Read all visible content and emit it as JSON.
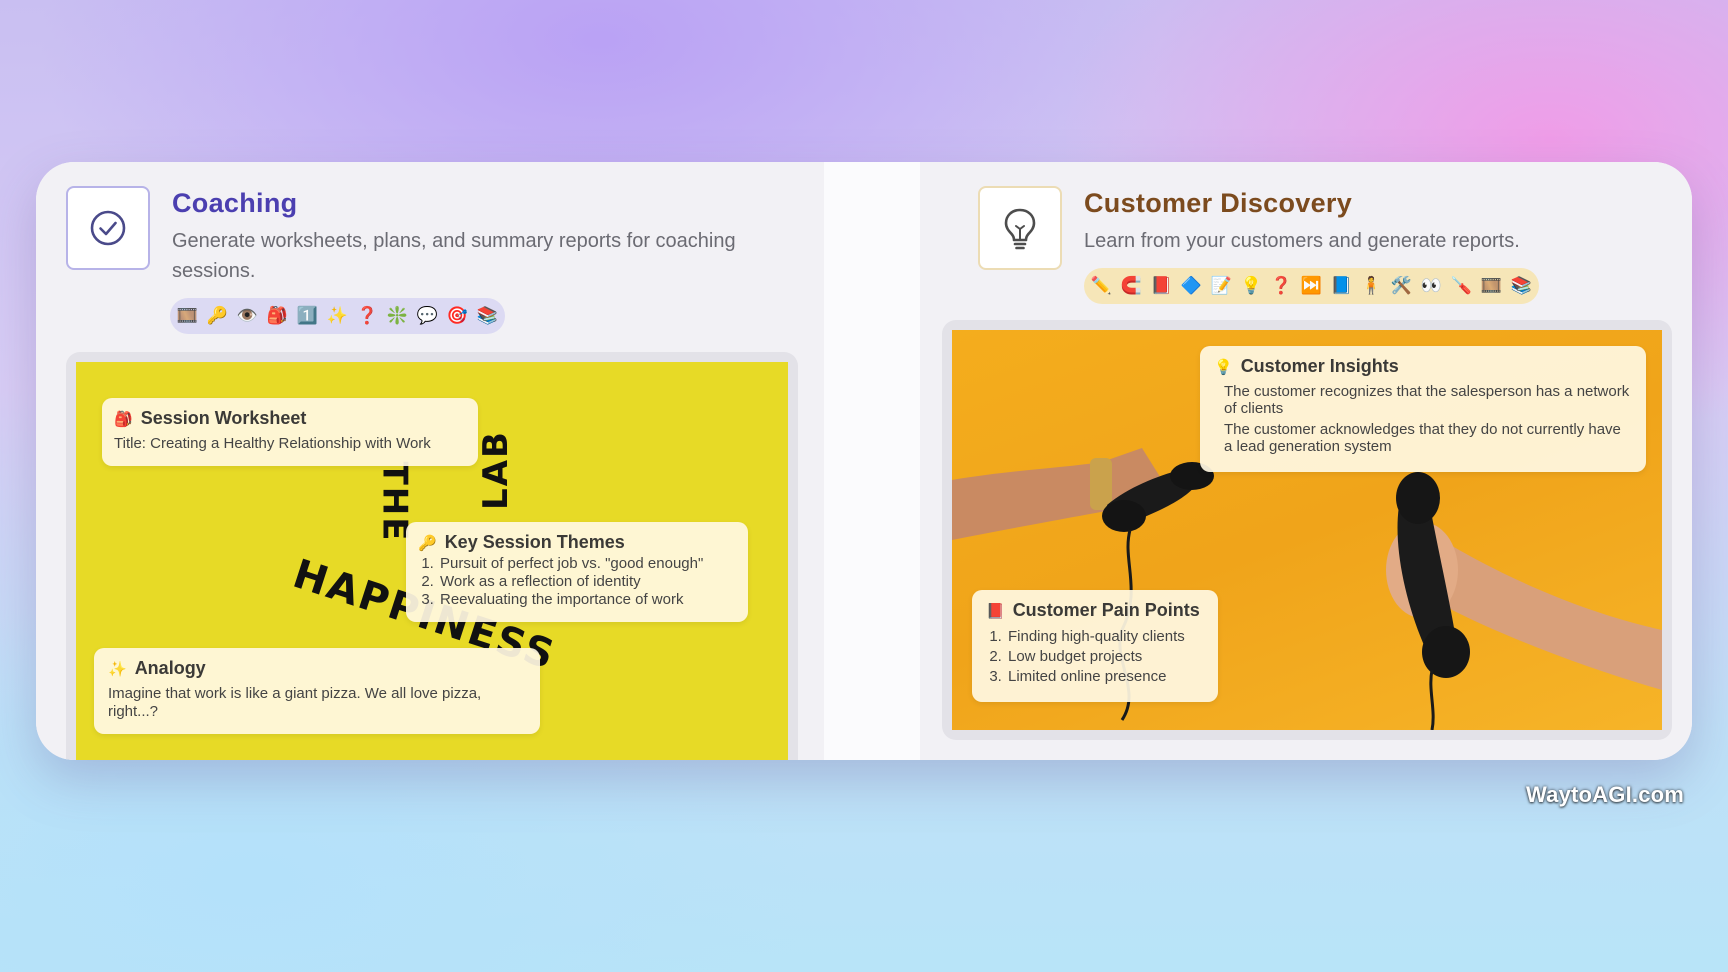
{
  "coaching": {
    "icon": "check-circle-icon",
    "title": "Coaching",
    "description": "Generate worksheets, plans, and summary reports for coaching sessions.",
    "emoji_strip": [
      "🎞️",
      "🔑",
      "👁️",
      "🎒",
      "1️⃣",
      "✨",
      "❓",
      "❇️",
      "💬",
      "🎯",
      "📚"
    ],
    "image_text": [
      "THE",
      "HAPPINESS",
      "LAB"
    ],
    "notes": {
      "worksheet": {
        "icon": "🎒",
        "heading": "Session Worksheet",
        "body": "Title: Creating a Healthy Relationship with Work"
      },
      "themes": {
        "icon": "🔑",
        "heading": "Key Session Themes",
        "items": [
          "Pursuit of perfect job vs. \"good enough\"",
          "Work as a reflection of identity",
          "Reevaluating the importance of work"
        ]
      },
      "analogy": {
        "icon": "✨",
        "heading": "Analogy",
        "body": "Imagine that work is like a giant pizza. We all love pizza, right...?"
      }
    }
  },
  "discovery": {
    "icon": "lightbulb-icon",
    "title": "Customer Discovery",
    "description": "Learn from your customers and generate reports.",
    "emoji_strip": [
      "✏️",
      "🧲",
      "📕",
      "🔷",
      "📝",
      "💡",
      "❓",
      "⏭️",
      "📘",
      "🧍",
      "🛠️",
      "👀",
      "🪛",
      "🎞️",
      "📚"
    ],
    "notes": {
      "insights": {
        "icon": "💡",
        "heading": "Customer Insights",
        "items": [
          "The customer recognizes that the salesperson has a network of clients",
          "The customer acknowledges that they do not currently have a lead generation system"
        ]
      },
      "pain": {
        "icon": "📕",
        "heading": "Customer Pain Points",
        "items": [
          "Finding high-quality clients",
          "Low budget projects",
          "Limited online presence"
        ]
      }
    }
  },
  "watermark": "WaytoAGI.com"
}
